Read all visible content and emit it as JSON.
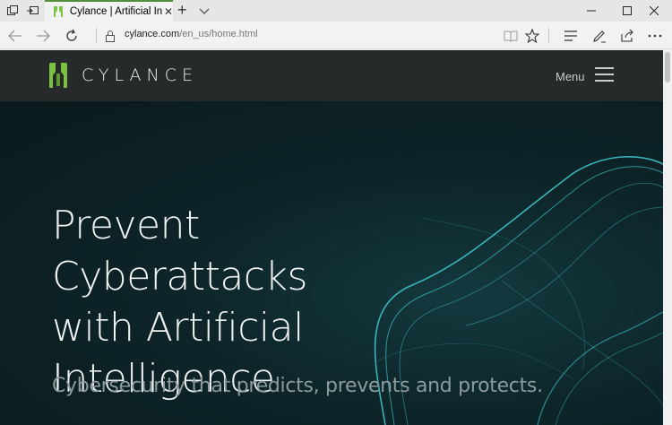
{
  "browser": {
    "tab": {
      "title": "Cylance | Artificial Intelli"
    },
    "url": {
      "domain": "cylance.com",
      "path": "/en_us/home.html"
    }
  },
  "site": {
    "brand": "CYLANCE",
    "menu_label": "Menu",
    "headline": [
      "Prevent",
      "Cyberattacks",
      "with Artificial",
      "Intelligence"
    ],
    "subheadline": "Cybersecurity that predicts, prevents and protects."
  },
  "colors": {
    "brand_green": "#7cc242",
    "header_bg": "#262a2b",
    "hero_bg": "#0e1e22",
    "wave": "#3fc3c9"
  },
  "icons": [
    "tab-manager-icon",
    "set-aside-tabs-icon",
    "cylance-favicon",
    "close-icon",
    "new-tab-icon",
    "chevron-down-icon",
    "minimize-icon",
    "maximize-icon",
    "close-window-icon",
    "back-icon",
    "forward-icon",
    "refresh-icon",
    "lock-icon",
    "reading-view-icon",
    "favorite-star-icon",
    "hub-icon",
    "web-note-icon",
    "share-icon",
    "more-icon",
    "hamburger-icon"
  ]
}
